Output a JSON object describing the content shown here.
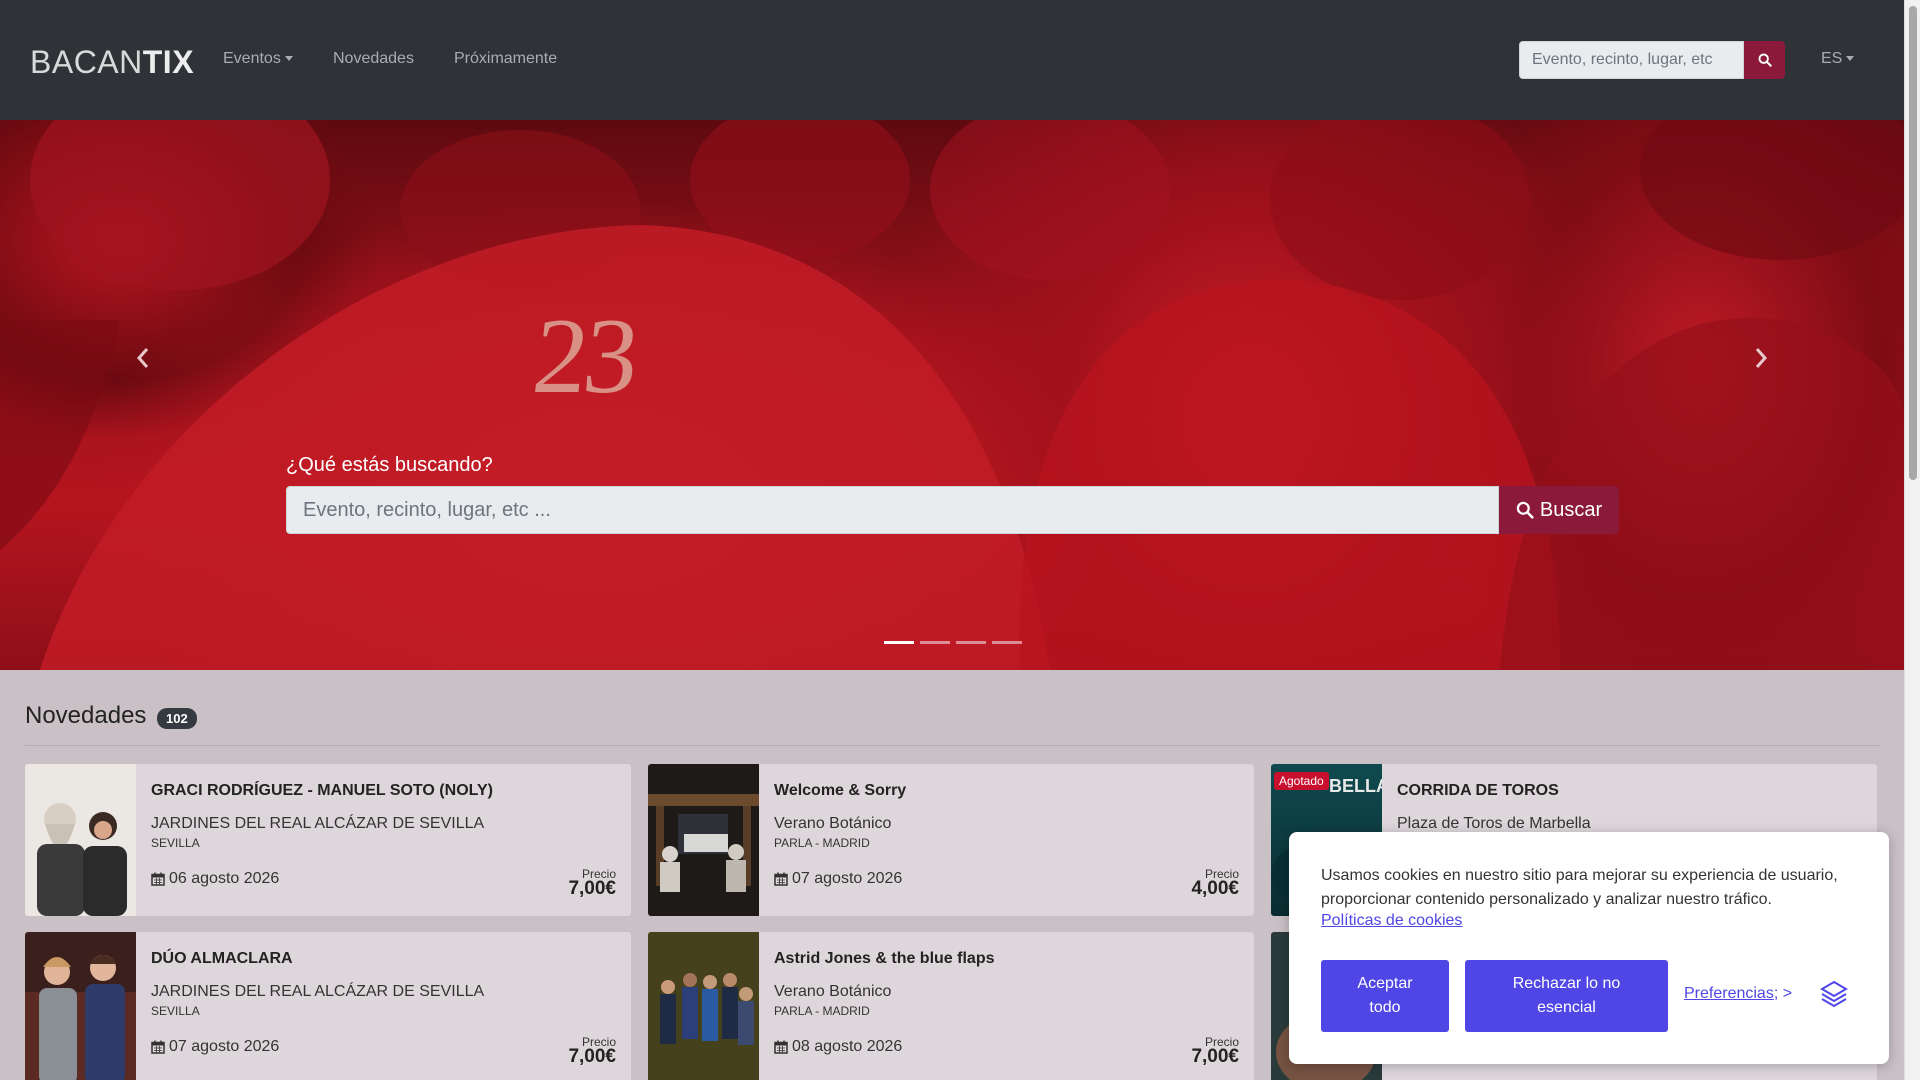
{
  "nav": {
    "logo_thin": "BACAN",
    "logo_bold": "TIX",
    "links": {
      "eventos": "Eventos",
      "novedades": "Novedades",
      "proximamente": "Próximamente"
    },
    "search_placeholder": "Evento, recinto, lugar, etc",
    "lang": "ES"
  },
  "hero": {
    "seat_number": "23",
    "question": "¿Qué estás buscando?",
    "search_placeholder": "Evento, recinto, lugar, etc ...",
    "search_button": "Buscar",
    "slides": 4,
    "active_slide": 1
  },
  "section": {
    "title": "Novedades",
    "count": "102"
  },
  "cards": [
    {
      "title": "GRACI RODRÍGUEZ - MANUEL SOTO (NOLY)",
      "venue": "JARDINES DEL REAL ALCÁZAR DE SEVILLA",
      "city": "SEVILLA",
      "date": "06 agosto 2026",
      "price_label": "Precio",
      "price": "7,00€"
    },
    {
      "title": "Welcome & Sorry",
      "venue": "Verano Botánico",
      "city": "PARLA - MADRID",
      "date": "07 agosto 2026",
      "price_label": "Precio",
      "price": "4,00€"
    },
    {
      "title": "CORRIDA DE TOROS",
      "venue": "Plaza de Toros de Marbella",
      "badge": "Agotado",
      "poster_text": "BELLA"
    },
    {
      "title": "DÚO ALMACLARA",
      "venue": "JARDINES DEL REAL ALCÁZAR DE SEVILLA",
      "city": "SEVILLA",
      "date": "07 agosto 2026",
      "price_label": "Precio",
      "price": "7,00€"
    },
    {
      "title": "Astrid Jones & the blue flaps",
      "venue": "Verano Botánico",
      "city": "PARLA - MADRID",
      "date": "08 agosto 2026",
      "price_label": "Precio",
      "price": "7,00€"
    }
  ],
  "cookie": {
    "text": "Usamos cookies en nuestro sitio para mejorar su experiencia de usuario, proporcionar contenido personalizado y analizar nuestro tráfico.",
    "policy_link": "Políticas de cookies",
    "accept": "Aceptar todo",
    "reject": "Rechazar lo no esencial",
    "preferences": "Preferencias",
    "preferences_suffix": "; >",
    "accent_color": "#4f46e5"
  },
  "colors": {
    "navbar": "#2f3337",
    "brand": "#8b1a3a",
    "page_bg": "#c9c1c6"
  }
}
